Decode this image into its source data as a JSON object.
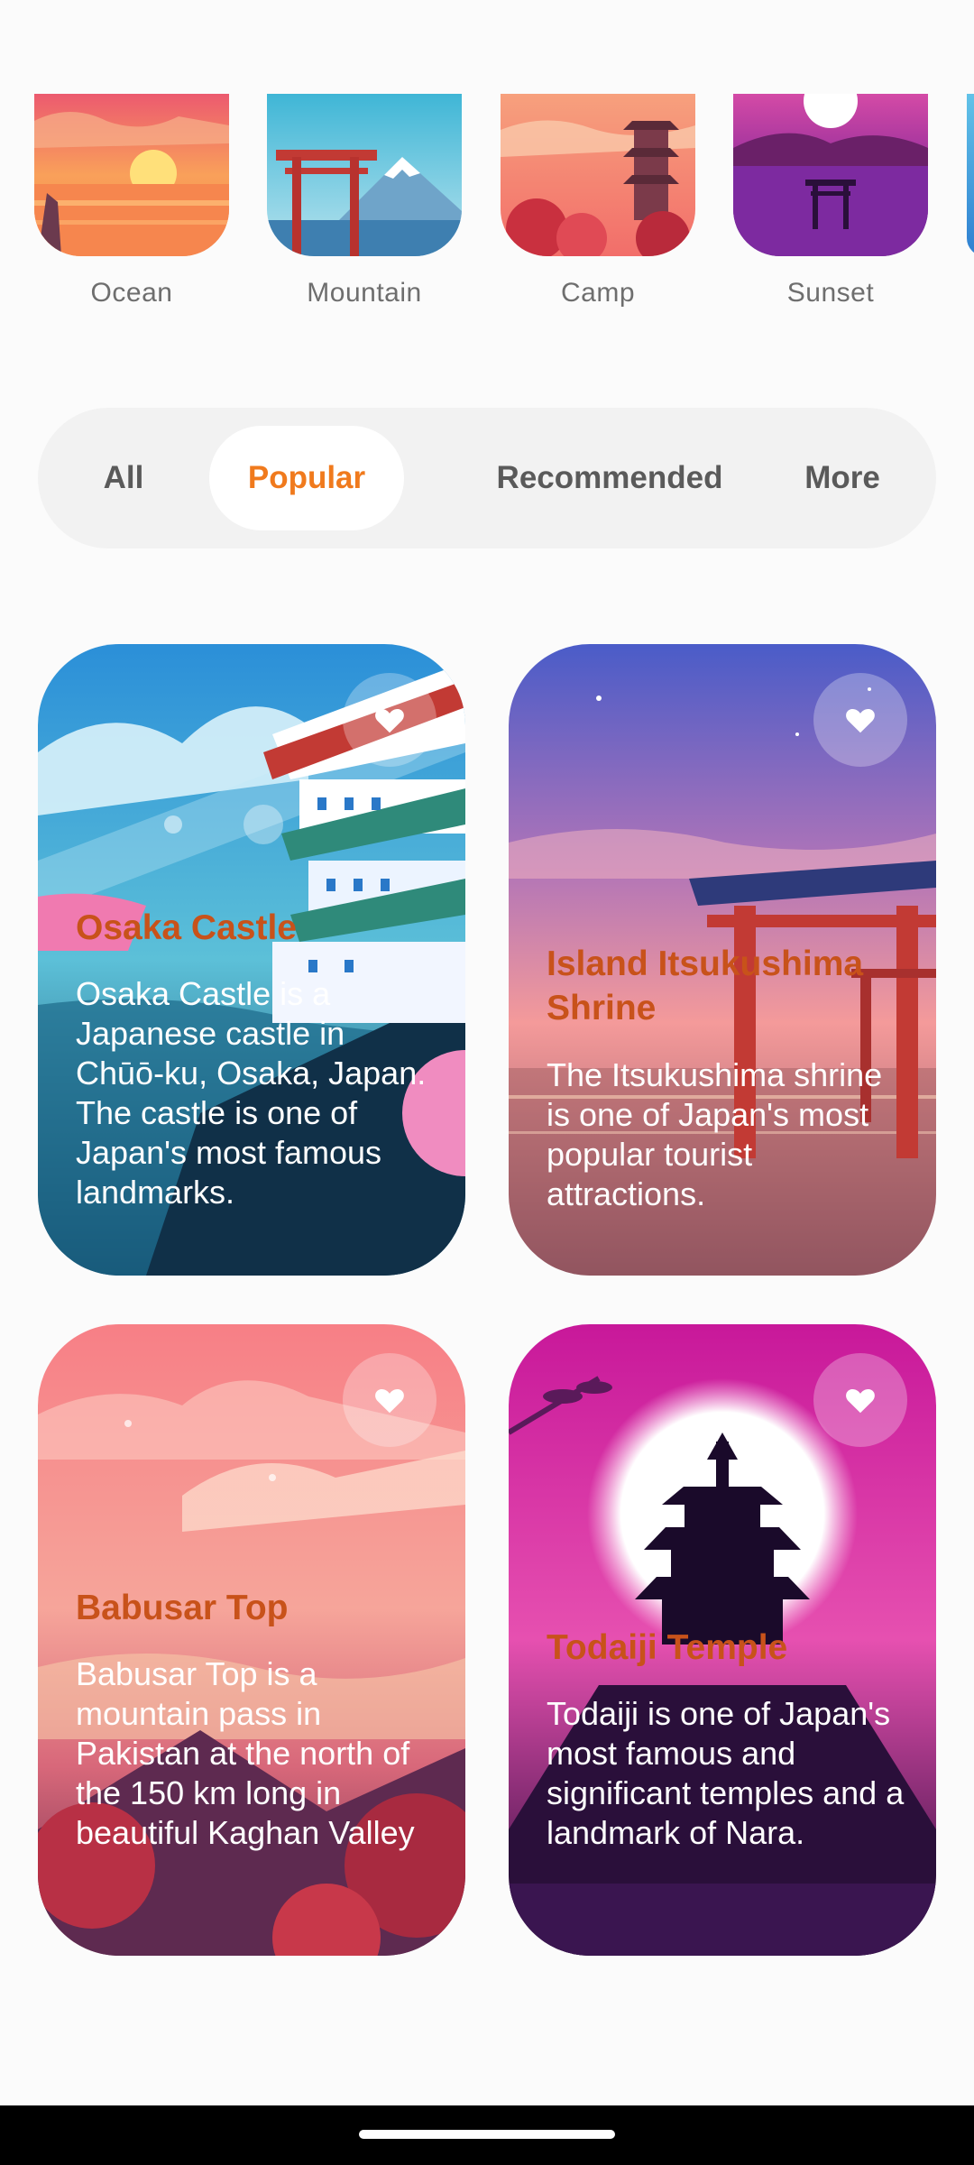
{
  "categories": [
    {
      "label": "Ocean",
      "icon": "ocean-sunset-thumbnail"
    },
    {
      "label": "Mountain",
      "icon": "mountain-torii-thumbnail"
    },
    {
      "label": "Camp",
      "icon": "camp-pagoda-thumbnail"
    },
    {
      "label": "Sunset",
      "icon": "sunset-torii-thumbnail"
    }
  ],
  "tabs": [
    {
      "label": "All",
      "active": false
    },
    {
      "label": "Popular",
      "active": true
    },
    {
      "label": "Recommended",
      "active": false
    },
    {
      "label": "More",
      "active": false
    }
  ],
  "cards": [
    {
      "title": "Osaka Castle",
      "description": "Osaka Castle is a Japanese castle in Chūō-ku, Osaka, Japan. The castle is one of Japan's most famous landmarks.",
      "icon": "heart-icon"
    },
    {
      "title": "Island Itsukushima Shrine",
      "description": "The Itsukushima shrine is one of Japan's most popular tourist attractions.",
      "icon": "heart-icon"
    },
    {
      "title": "Babusar Top",
      "description": "Babusar Top is a mountain pass in Pakistan at the north of the 150 km long in beautiful Kaghan Valley",
      "icon": "heart-icon"
    },
    {
      "title": "Todaiji Temple",
      "description": "Todaiji is one of Japan's most famous and significant temples and a landmark of Nara.",
      "icon": "heart-icon"
    }
  ],
  "colors": {
    "accent": "#f07a1d",
    "card_title": "#c8521a",
    "tab_bar_bg": "#f2f2f2"
  }
}
